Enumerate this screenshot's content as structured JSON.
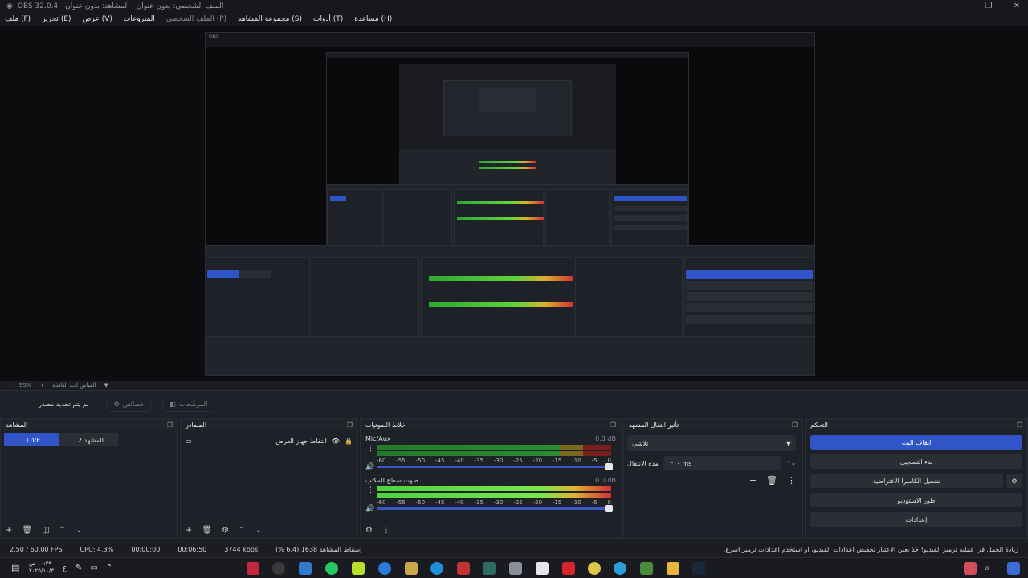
{
  "window": {
    "title": "OBS 32.0.4 - الملف الشخصي: بدون عنوان - المشاهد: بدون عنوان",
    "controls": [
      "—",
      "❐",
      "✕"
    ]
  },
  "menu": [
    {
      "label": "ملف (F)",
      "dim": false
    },
    {
      "label": "تحرير (E)",
      "dim": false
    },
    {
      "label": "عرض (V)",
      "dim": false
    },
    {
      "label": "المنزوعات",
      "dim": false
    },
    {
      "label": "الملف الشخصي (P)",
      "dim": true
    },
    {
      "label": "مجموعة المشاهد (S)",
      "dim": false
    },
    {
      "label": "أدوات (T)",
      "dim": false
    },
    {
      "label": "مساعدة (H)",
      "dim": false
    }
  ],
  "zoom": {
    "value": "59%",
    "minus": "−",
    "plus": "+",
    "label": "القياس لحد النافذة",
    "dropdown": "▼"
  },
  "toolbar": {
    "no_source": "لم يتم تحديد مصدر",
    "properties": "خصائص",
    "filters": "المرشّحات"
  },
  "scenes": {
    "header": "المشاهد",
    "live": "LIVE",
    "scene2": "المشهد 2"
  },
  "sources": {
    "header": "المصادر",
    "item": "التقاط جهاز العرض"
  },
  "mixer": {
    "header": "خلاط الصوتيات",
    "channels": [
      {
        "name": "Mic/Aux",
        "db": "0.0 dB"
      },
      {
        "name": "صوت سطح المكتب",
        "db": "0.0 dB"
      }
    ],
    "ticks": [
      "-60",
      "-55",
      "-50",
      "-45",
      "-40",
      "-35",
      "-30",
      "-25",
      "-20",
      "-15",
      "-10",
      "-5",
      "0"
    ]
  },
  "transitions": {
    "header": "تأثير انتقال المشهد",
    "selected": "تلاشي",
    "duration_label": "مدة الانتقال",
    "duration_value": "٣٠٠ ms"
  },
  "controls": {
    "header": "التحكم",
    "stop_stream": "ايقاف البث",
    "start_record": "بدء التسجيل",
    "virtual_cam": "تشغيل الكاميرا الافتراضية",
    "studio_mode": "طور الاستوديو",
    "settings": "إعدادات"
  },
  "status": {
    "warning": "زيادة الحمل في عملية ترميز الفيديو! خذ بعين الاعتبار تخفيض اعدادات الفيديو، او استخدم اعدادات ترميز اسرع.",
    "dropped": "إسقاط المشاهد 1638 (6.4 %)",
    "bitrate": "3744 kbps",
    "stream_time": "00:06:50",
    "rec_time": "00:00:00",
    "cpu": "CPU: 4.3%",
    "fps": "2.50 / 60.00 FPS"
  },
  "taskbar": {
    "time": "١٠:٢٩ ص",
    "date": "٢٠٢٥/١٠/٣"
  }
}
